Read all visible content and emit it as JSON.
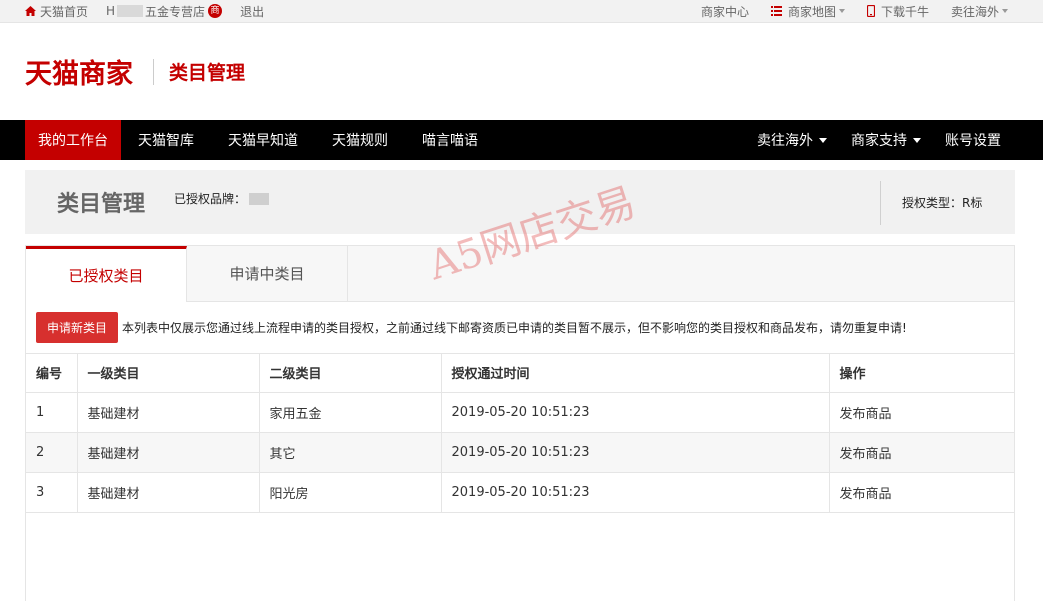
{
  "topbar": {
    "home": "天猫首页",
    "shop_prefix": "H",
    "shop_name": "五金专营店",
    "shop_badge": "商",
    "logout": "退出",
    "merchant_center": "商家中心",
    "merchant_map": "商家地图",
    "download": "下载千牛",
    "sell_overseas": "卖往海外"
  },
  "header": {
    "logo": "天猫商家",
    "subtitle": "类目管理"
  },
  "nav": {
    "left": [
      "我的工作台",
      "天猫智库",
      "天猫早知道",
      "天猫规则",
      "喵言喵语"
    ],
    "right": [
      "卖往海外",
      "商家支持",
      "账号设置"
    ]
  },
  "title_card": {
    "title": "类目管理",
    "brand_label": "已授权品牌：",
    "auth_type": "授权类型：R标"
  },
  "tabs": [
    "已授权类目",
    "申请中类目"
  ],
  "notice": {
    "button": "申请新类目",
    "text": "本列表中仅展示您通过线上流程申请的类目授权，之前通过线下邮寄资质已申请的类目暂不展示，但不影响您的类目授权和商品发布，请勿重复申请!"
  },
  "table": {
    "headers": [
      "编号",
      "一级类目",
      "二级类目",
      "授权通过时间",
      "操作"
    ],
    "rows": [
      [
        "1",
        "基础建材",
        "家用五金",
        "2019-05-20 10:51:23",
        "发布商品"
      ],
      [
        "2",
        "基础建材",
        "其它",
        "2019-05-20 10:51:23",
        "发布商品"
      ],
      [
        "3",
        "基础建材",
        "阳光房",
        "2019-05-20 10:51:23",
        "发布商品"
      ]
    ]
  },
  "watermark": "A5网店交易",
  "colors": {
    "brand": "#c40000",
    "button": "#d7302e",
    "link": "#2c7fc2"
  }
}
